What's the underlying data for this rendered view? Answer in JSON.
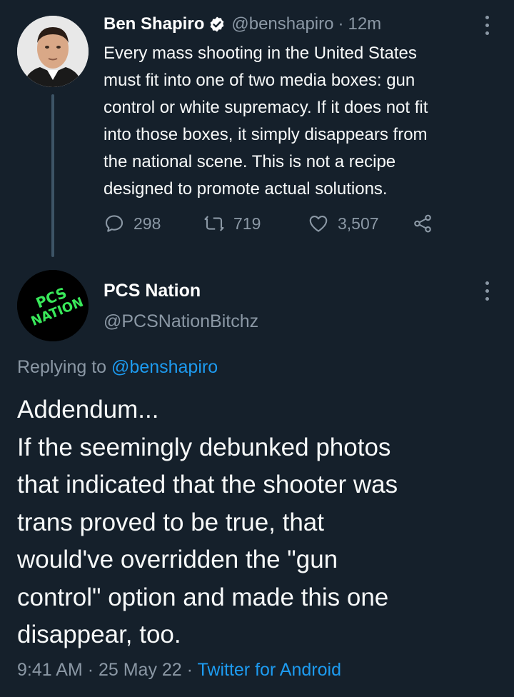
{
  "tweet1": {
    "author_name": "Ben Shapiro",
    "handle": "@benshapiro",
    "separator": "·",
    "time": "12m",
    "body_lines": [
      "Every mass shooting in the United States",
      "must fit into one of two media boxes: gun",
      "control or white supremacy. If it does not fit",
      "into those boxes, it simply disappears from",
      "the national scene. This is not a recipe",
      "designed to promote actual solutions."
    ],
    "replies": "298",
    "retweets": "719",
    "likes": "3,507"
  },
  "tweet2": {
    "author_name": "PCS Nation",
    "handle": "@PCSNationBitchz",
    "replying_prefix": "Replying to",
    "replying_to": "@benshapiro",
    "body_lines": [
      "Addendum...",
      "If the seemingly debunked photos",
      "that indicated that the shooter was",
      "trans proved to be true, that",
      "would've overridden the \"gun",
      "control\" option and made this one",
      "disappear, too."
    ],
    "time": "9:41 AM",
    "sep1": "·",
    "date": "25 May 22",
    "sep2": "·",
    "source": "Twitter for Android",
    "avatar_logo_text": "PCS NATION"
  },
  "colors": {
    "background": "#15202b",
    "secondary_text": "#8b98a5",
    "link": "#1d9bf0",
    "verified_badge": "#ffffff",
    "logo_green": "#39e85a"
  },
  "icons": [
    "verified-badge-icon",
    "more-options-icon",
    "reply-icon",
    "retweet-icon",
    "like-icon",
    "share-icon"
  ]
}
